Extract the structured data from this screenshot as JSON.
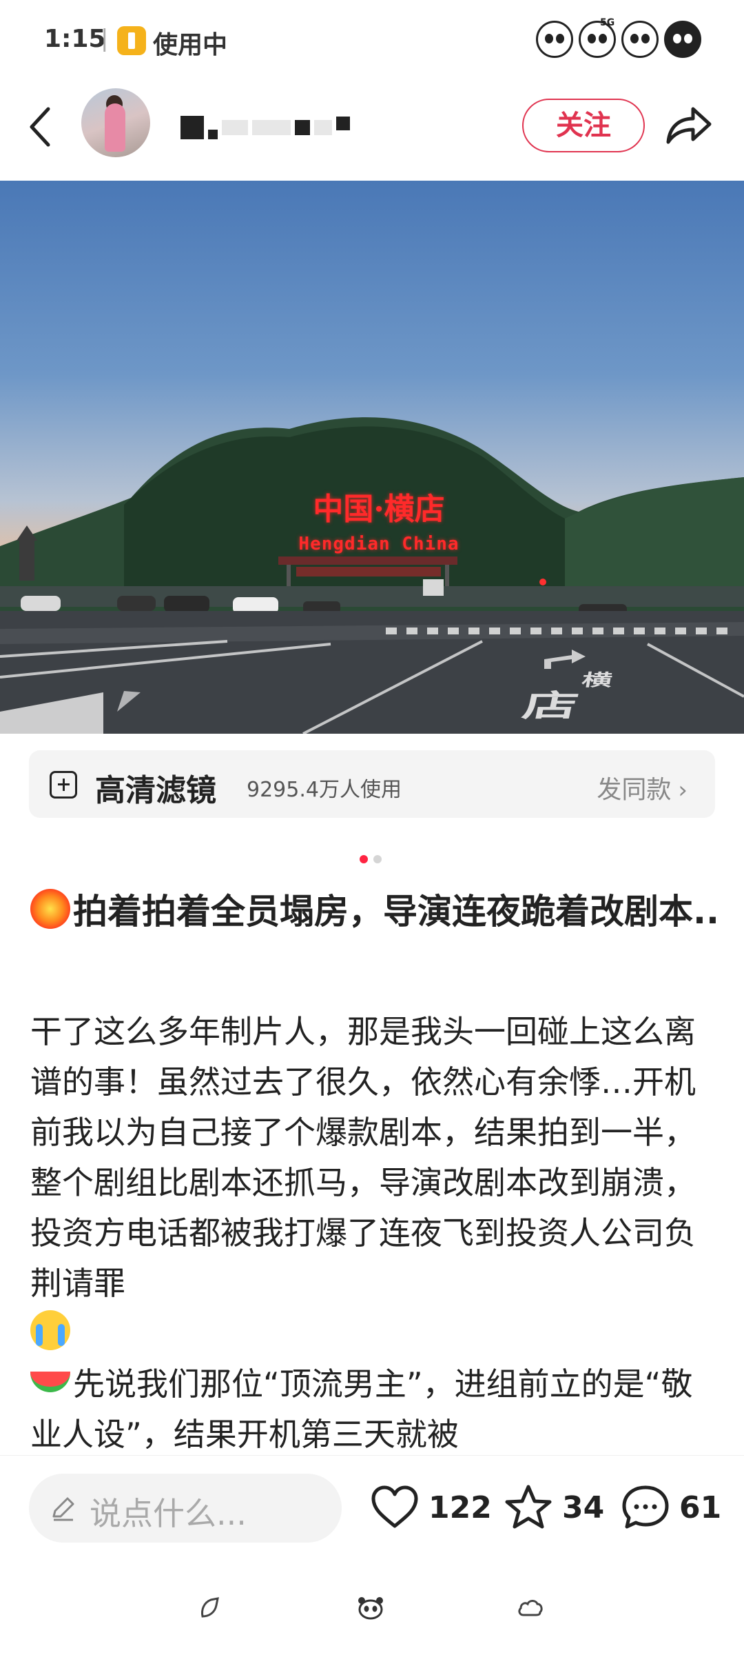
{
  "status_bar": {
    "time": "1:15",
    "separator": "|",
    "app_label": "使用中",
    "network": "5G",
    "icons": [
      "panda-icon",
      "panda-5g-icon",
      "panda-wifi-icon",
      "panda-battery-icon"
    ]
  },
  "header": {
    "follow_label": "关注",
    "icons": [
      "back-icon",
      "share-icon"
    ]
  },
  "photo": {
    "sign_cn": "中国·横店",
    "sign_en": "Hengdian China",
    "road_text": "店",
    "road_text_2": "横"
  },
  "filter": {
    "name": "高清滤镜",
    "users": "9295.4万人使用",
    "action": "发同款",
    "chevron": "›"
  },
  "pagination": {
    "total": 2,
    "active": 1
  },
  "post": {
    "title": "拍着拍着全员塌房，导演连夜跪着改剧本..",
    "body_1": "干了这么多年制片人，那是我头一回碰上这么离谱的事！虽然过去了很久，依然心有余悸…开机前我以为自己接了个爆款剧本，结果拍到一半，整个剧组比剧本还抓马，导演改剧本改到崩溃，投资方电话都被我打爆了连夜飞到投资人公司负荆请罪",
    "body_2": "先说我们那位“顶流男主”，进组前立的是“敬业人设”，结果开机第三天就被"
  },
  "actions": {
    "comment_placeholder": "说点什么...",
    "likes": "122",
    "favorites": "34",
    "comments": "61"
  },
  "colors": {
    "accent": "#ff2442",
    "follow": "#e0334f"
  }
}
